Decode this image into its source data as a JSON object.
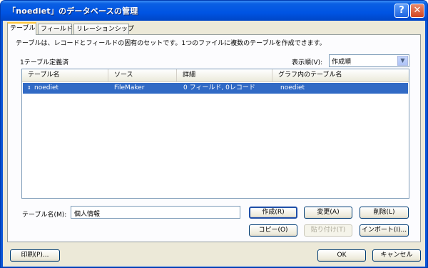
{
  "window": {
    "title": "「noediet」のデータベースの管理",
    "help_label": "?",
    "close_label": "✕"
  },
  "tabs": [
    {
      "label": "テーブル"
    },
    {
      "label": "フィールド"
    },
    {
      "label": "リレーションシップ"
    }
  ],
  "description": "テーブルは、レコードとフィールドの固有のセットです。1つのファイルに複数のテーブルを作成できます。",
  "table_count_label": "1テーブル定義済",
  "sort": {
    "label": "表示順(V):",
    "value": "作成順"
  },
  "list": {
    "columns": [
      "テーブル名",
      "ソース",
      "詳細",
      "グラフ内のテーブル名"
    ],
    "rows": [
      {
        "name": "noediet",
        "source": "FileMaker",
        "detail": "0 フィールド, 0レコード",
        "graph_name": "noediet",
        "selected": true
      }
    ]
  },
  "table_name": {
    "label": "テーブル名(M):",
    "value": "個人情報"
  },
  "buttons": {
    "create": "作成(R)",
    "change": "変更(A)",
    "delete": "削除(L)",
    "copy": "コピー(O)",
    "paste": "貼り付け(T)",
    "import": "インポート(I)...",
    "print": "印刷(P)...",
    "ok": "OK",
    "cancel": "キャンセル"
  },
  "icons": {
    "close": "close-icon",
    "help": "help-icon",
    "dropdown": "chevron-down-icon",
    "row_marker": "sort-arrows-icon"
  }
}
